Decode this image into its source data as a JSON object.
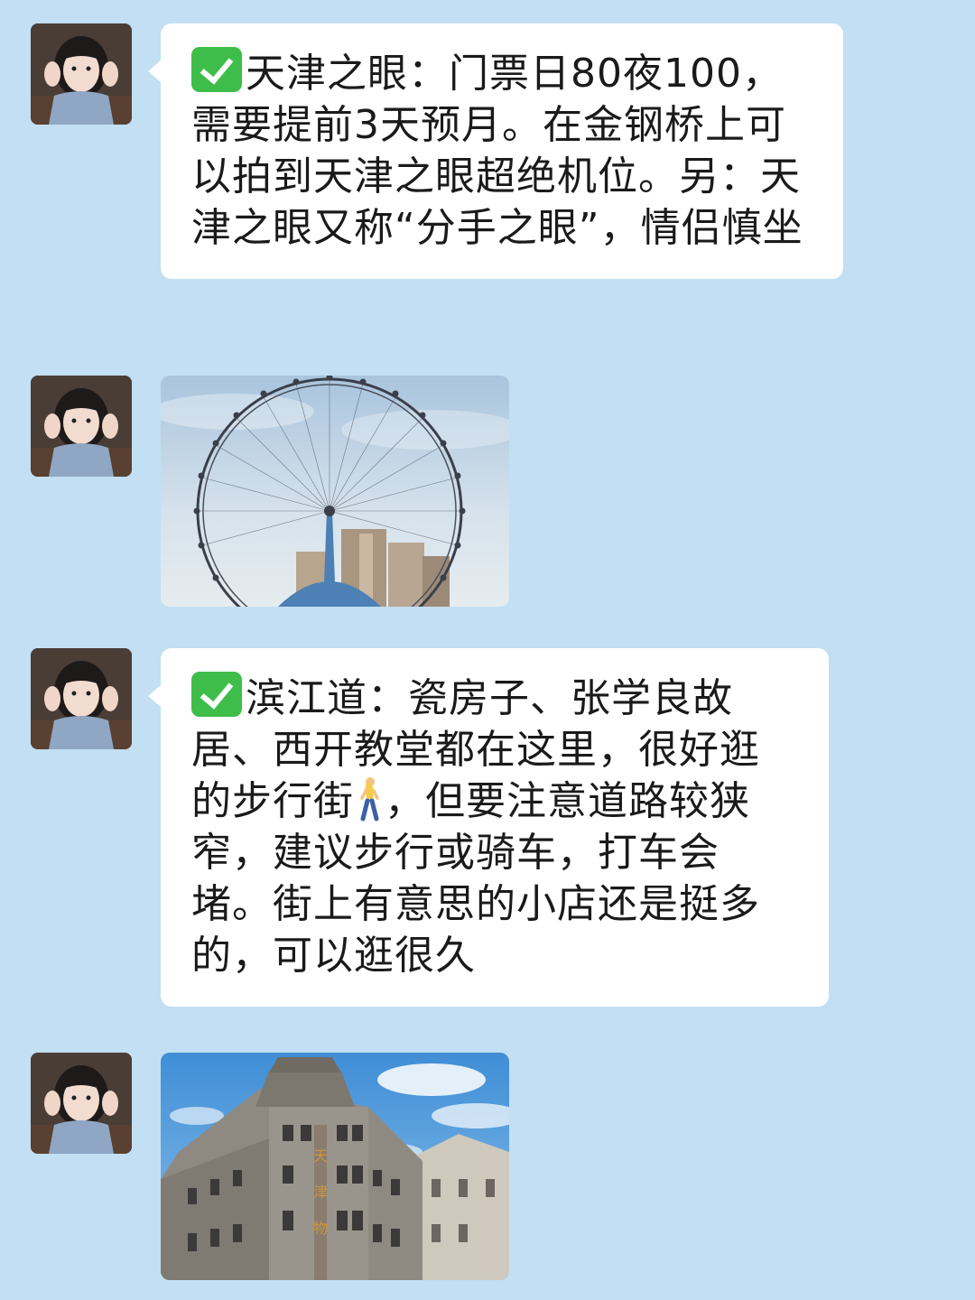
{
  "messages": [
    {
      "type": "text",
      "text": "天津之眼：门票日80夜100，需要提前3天预月。在金钢桥上可以拍到天津之眼超绝机位。另：天津之眼又称“分手之眼”，情侣慎坐"
    },
    {
      "type": "image",
      "subject": "ferris-wheel-photo"
    },
    {
      "type": "text",
      "text_part1": "滨江道：瓷房子、张学良故居、西开教堂都在这里，很好逛的步行街",
      "text_part2": "，但要注意道路较狭窄，建议步行或骑车，打车会堵。街上有意思的小店还是挺多的，可以逛很久"
    },
    {
      "type": "image",
      "subject": "historic-building-photo",
      "sign_text": "天津物"
    }
  ],
  "colors": {
    "background": "#c2dff3",
    "bubble": "#ffffff",
    "check_green": "#3fbd4a",
    "text": "#1a1a1a"
  },
  "icons": [
    "check-mark-icon",
    "walking-person-icon"
  ]
}
